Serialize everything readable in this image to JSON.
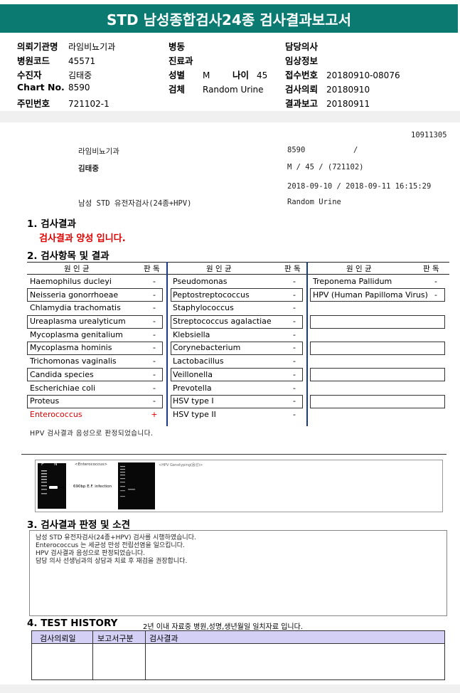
{
  "title": "STD 남성종합검사24종 검사결과보고서",
  "header_info": {
    "left": [
      {
        "label": "의뢰기관명",
        "value": "라임비뇨기과"
      },
      {
        "label": "병원코드",
        "value": "45571"
      },
      {
        "label": "수진자",
        "value": "김태중"
      },
      {
        "label": "Chart No.",
        "value": "8590"
      },
      {
        "label": "주민번호",
        "value": "721102-1"
      }
    ],
    "middle": {
      "ward_label": "병동",
      "dept_label": "진료과",
      "sex_label": "성별",
      "sex_value": "M",
      "age_label": "나이",
      "age_value": "45",
      "specimen_label": "검체",
      "specimen_value": "Random Urine"
    },
    "right": [
      {
        "label": "담당의사",
        "value": ""
      },
      {
        "label": "임상정보",
        "value": ""
      },
      {
        "label": "접수번호",
        "value": "20180910-08076"
      },
      {
        "label": "검사의뢰",
        "value": "20180910"
      },
      {
        "label": "결과보고",
        "value": "20180911"
      }
    ]
  },
  "report_meta": {
    "code": "10911305",
    "clinic": "라임비뇨기과",
    "chart": "8590",
    "chart_slash": "/",
    "patient": "김태중",
    "sexage": "M /    45 / (721102)",
    "dates": "2018-09-10       / 2018-09-11 16:15:29",
    "test_name": "남성 STD 유전자검사(24종+HPV)",
    "specimen": "Random Urine"
  },
  "section1": {
    "heading": "1. 검사결과",
    "result": "검사결과 양성 입니다."
  },
  "section2": {
    "heading": "2. 검사항목 및 결과",
    "col_pathogen": "원  인  균",
    "col_result": "판 독",
    "col1": [
      {
        "name": "Haemophilus ducleyi",
        "result": "-"
      },
      {
        "name": "Neisseria gonorrhoeae",
        "result": "-"
      },
      {
        "name": "Chlamydia trachomatis",
        "result": "-"
      },
      {
        "name": "Ureaplasma urealyticum",
        "result": "-"
      },
      {
        "name": "Mycoplasma genitalium",
        "result": "-"
      },
      {
        "name": "Mycoplasma hominis",
        "result": "-"
      },
      {
        "name": "Trichomonas vaginalis",
        "result": "-"
      },
      {
        "name": "Candida species",
        "result": "-"
      },
      {
        "name": "Escherichiae coli",
        "result": "-"
      },
      {
        "name": "Proteus",
        "result": "-"
      },
      {
        "name": "Enterococcus",
        "result": "+"
      }
    ],
    "col2": [
      {
        "name": "Pseudomonas",
        "result": "-"
      },
      {
        "name": "Peptostreptococcus",
        "result": "-"
      },
      {
        "name": "Staphylococcus",
        "result": "-"
      },
      {
        "name": "Streptococcus agalactiae",
        "result": "-"
      },
      {
        "name": "Klebsiella",
        "result": "-"
      },
      {
        "name": "Corynebacterium",
        "result": "-"
      },
      {
        "name": "Lactobacillus",
        "result": "-"
      },
      {
        "name": "Veillonella",
        "result": "-"
      },
      {
        "name": "Prevotella",
        "result": "-"
      },
      {
        "name": "HSV type I",
        "result": "-"
      },
      {
        "name": "HSV type II",
        "result": "-"
      }
    ],
    "col3": [
      {
        "name": "Treponema Pallidum",
        "result": "-"
      },
      {
        "name": "HPV (Human Papilloma Virus)",
        "result": "-"
      }
    ],
    "hpv_note": "HPV 검사결과 음성으로 판정되었습니다.",
    "positive_color": "#e00000"
  },
  "gel_image": {
    "lane_p": "P",
    "lane_n": "N",
    "caption_left": "<Enterococcus>",
    "band_label": "690bp E.F. infection",
    "caption_right": "<HPV Genotyping(음성)>"
  },
  "section3": {
    "heading": "3. 검사결과 판정 및 소견",
    "lines": [
      "남성 STD 유전자검사(24종+HPV) 검사를 시행하였습니다.",
      "Enterococcus 는 세균성 만성 전립선염을 일으킵니다.",
      "HPV 검사결과 음성으로 판정되었습니다.",
      "담당 의사 선생님과의 상담과 치료 후 재검을 권장합니다."
    ]
  },
  "section4": {
    "heading": "4. TEST HISTORY",
    "note": "2년 이내 자료중 병원,성명,생년월일 일치자료 입니다.",
    "columns": [
      "검사의뢰일",
      "보고서구분",
      "검사결과"
    ]
  },
  "colors": {
    "banner": "#0b7b72",
    "positive": "#e00000",
    "divider": "#1a3a8a",
    "history_header": "#d4d0f5"
  }
}
